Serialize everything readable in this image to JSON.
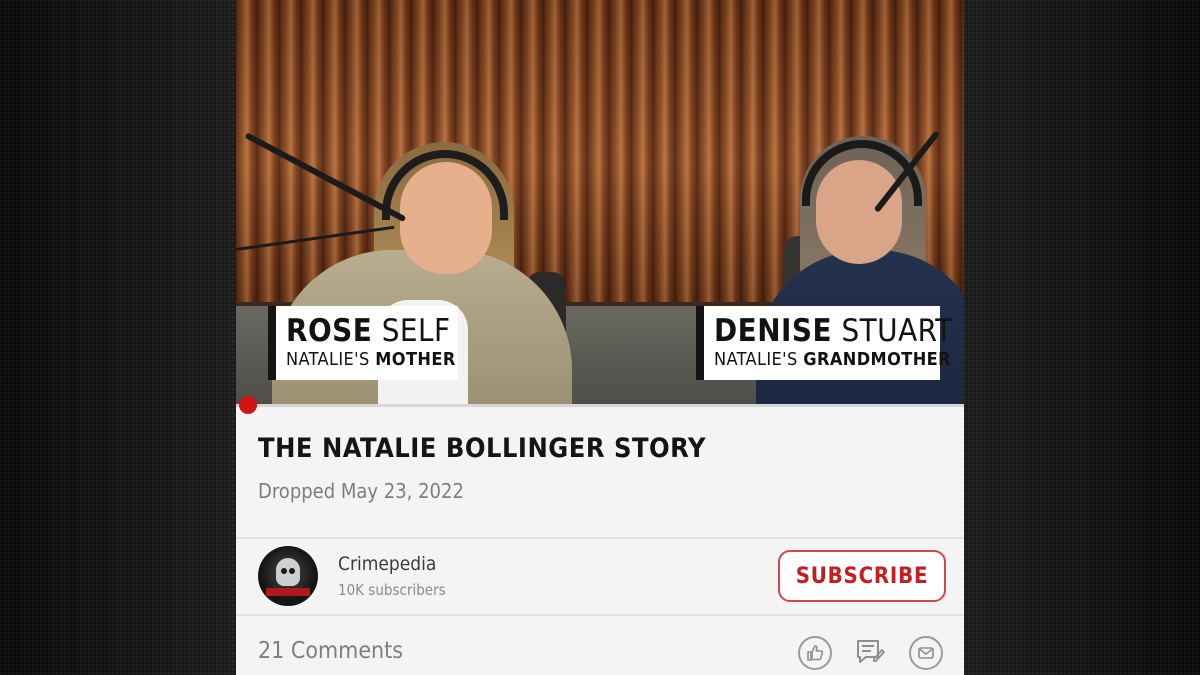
{
  "lower_thirds": [
    {
      "first": "ROSE",
      "last": "SELF",
      "role_prefix": "NATALIE'S",
      "role": "MOTHER"
    },
    {
      "first": "DENISE",
      "last": "STUART",
      "role_prefix": "NATALIE'S",
      "role": "GRANDMOTHER"
    }
  ],
  "video": {
    "title": "THE NATALIE BOLLINGER STORY",
    "date": "Dropped May 23, 2022",
    "progress": 0.0
  },
  "channel": {
    "name": "Crimepedia",
    "subscribers": "10K subscribers",
    "avatar_icon": "skull-logo-icon",
    "avatar_text": "CRIMEPEDIA"
  },
  "subscribe_label": "SUBSCRIBE",
  "comments": {
    "label": "21 Comments"
  },
  "actions": [
    "thumbs-up-icon",
    "comment-icon",
    "share-icon"
  ],
  "colors": {
    "accent": "#d31414",
    "subscribe": "#c41e24"
  }
}
